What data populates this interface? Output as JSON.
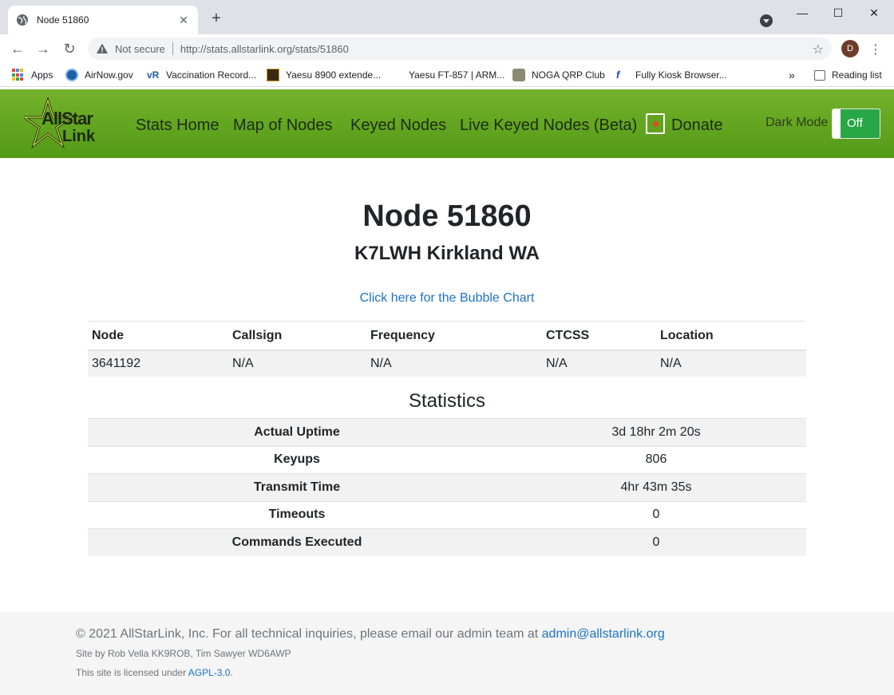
{
  "browser": {
    "tab_title": "Node 51860",
    "new_tab": "+",
    "not_secure": "Not secure",
    "url": "http://stats.allstarlink.org/stats/51860",
    "avatar_letter": "D",
    "bookmarks": [
      {
        "label": "Apps"
      },
      {
        "label": "AirNow.gov"
      },
      {
        "label": "Vaccination Record..."
      },
      {
        "label": "Yaesu 8900 extende..."
      },
      {
        "label": "Yaesu FT-857 | ARM..."
      },
      {
        "label": "NOGA QRP Club"
      },
      {
        "label": "Fully Kiosk Browser..."
      }
    ],
    "more": "»",
    "reading_list": "Reading list"
  },
  "site": {
    "logo_text": "AllStar Link",
    "nav": [
      "Stats Home",
      "Map of Nodes",
      "Keyed Nodes",
      "Live Keyed Nodes (Beta)",
      "Donate"
    ],
    "dark_mode_label": "Dark Mode",
    "dark_mode_state": "Off",
    "accent": "#28a745"
  },
  "page": {
    "title": "Node 51860",
    "subtitle": "K7LWH Kirkland WA",
    "bubble_link": "Click here for the Bubble Chart",
    "node_table": {
      "headers": [
        "Node",
        "Callsign",
        "Frequency",
        "CTCSS",
        "Location"
      ],
      "row": [
        "3641192",
        "N/A",
        "N/A",
        "N/A",
        "N/A"
      ]
    },
    "statistics_title": "Statistics",
    "statistics": [
      {
        "label": "Actual Uptime",
        "value": "3d 18hr 2m 20s"
      },
      {
        "label": "Keyups",
        "value": "806"
      },
      {
        "label": "Transmit Time",
        "value": "4hr 43m 35s"
      },
      {
        "label": "Timeouts",
        "value": "0"
      },
      {
        "label": "Commands Executed",
        "value": "0"
      }
    ]
  },
  "footer": {
    "copyright": "© 2021 AllStarLink, Inc. For all technical inquiries, please email our admin team at",
    "email": "admin@allstarlink.org",
    "credits": "Site by Rob Vella KK9ROB, Tim Sawyer WD6AWP",
    "license_prefix": "This site is licensed under",
    "license": "AGPL-3.0",
    "license_suffix": "."
  }
}
